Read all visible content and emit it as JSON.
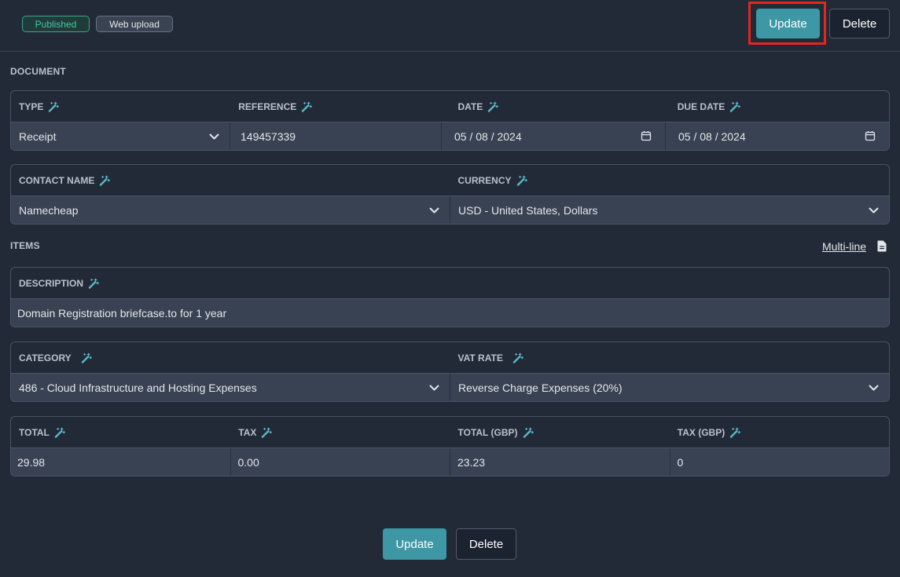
{
  "header": {
    "status_badge": "Published",
    "source_badge": "Web upload",
    "update_label": "Update",
    "delete_label": "Delete"
  },
  "document": {
    "heading": "DOCUMENT",
    "type": {
      "label": "TYPE",
      "value": "Receipt"
    },
    "reference": {
      "label": "REFERENCE",
      "value": "149457339"
    },
    "date": {
      "label": "DATE",
      "value": "05 / 08 / 2024"
    },
    "due_date": {
      "label": "DUE DATE",
      "value": "05 / 08 / 2024"
    },
    "contact_name": {
      "label": "CONTACT NAME",
      "value": "Namecheap"
    },
    "currency": {
      "label": "CURRENCY",
      "value": "USD - United States, Dollars"
    }
  },
  "items": {
    "heading": "ITEMS",
    "multiline_label": "Multi-line",
    "description": {
      "label": "DESCRIPTION",
      "value": "Domain Registration briefcase.to for 1 year"
    },
    "category": {
      "label": "CATEGORY",
      "value": "486 - Cloud Infrastructure and Hosting Expenses"
    },
    "vat_rate": {
      "label": "VAT RATE",
      "value": "Reverse Charge Expenses (20%)"
    },
    "total": {
      "label": "TOTAL",
      "value": "29.98"
    },
    "tax": {
      "label": "TAX",
      "value": "0.00"
    },
    "total_gbp": {
      "label": "TOTAL (GBP)",
      "value": "23.23"
    },
    "tax_gbp": {
      "label": "TAX (GBP)",
      "value": "0"
    }
  },
  "footer": {
    "update_label": "Update",
    "delete_label": "Delete"
  },
  "icons": {
    "field_indicator": "magic-wand-icon",
    "select": "chevron-down-icon",
    "date": "calendar-icon",
    "multiline": "document-icon"
  },
  "colors": {
    "background": "#222a38",
    "accent": "#3d97a4",
    "published": "#4cc79a",
    "highlight": "#e4261c",
    "icon": "#5cb8c8"
  }
}
